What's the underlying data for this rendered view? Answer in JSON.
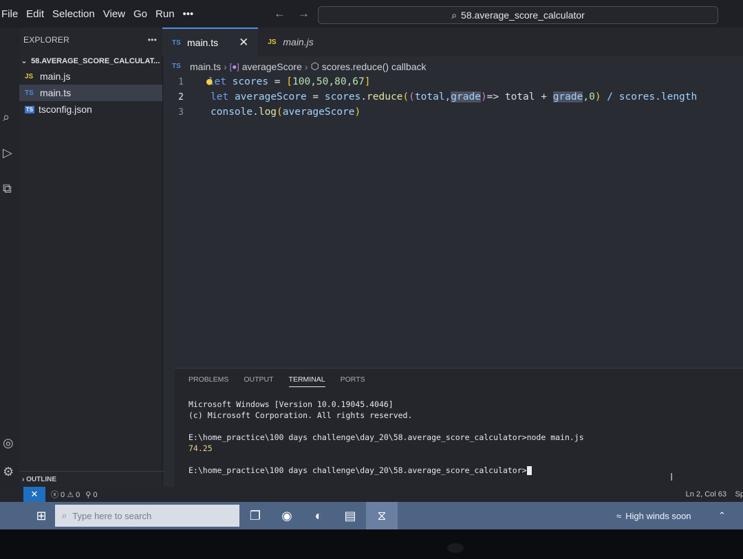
{
  "menu": {
    "items": [
      "File",
      "Edit",
      "Selection",
      "View",
      "Go",
      "Run",
      "•••"
    ]
  },
  "nav": {
    "back": "←",
    "forward": "→"
  },
  "command_center": {
    "text": "58.average_score_calculator"
  },
  "sidebar": {
    "title": "EXPLORER",
    "more": "•••",
    "folder": "58.AVERAGE_SCORE_CALCULAT...",
    "files": [
      {
        "icon": "JS",
        "name": "main.js"
      },
      {
        "icon": "TS",
        "name": "main.ts"
      },
      {
        "icon": "TS",
        "name": "tsconfig.json"
      }
    ],
    "outline": "OUTLINE"
  },
  "tabs": [
    {
      "icon": "TS",
      "label": "main.ts",
      "close": "✕"
    },
    {
      "icon": "JS",
      "label": "main.js"
    }
  ],
  "breadcrumb": {
    "file": "main.ts",
    "symbol1": "averageScore",
    "symbol2": "scores.reduce() callback"
  },
  "code": {
    "line_numbers": [
      "1",
      "2",
      "3"
    ],
    "line1": {
      "kw": "let",
      "var": "scores",
      "eq": " = ",
      "open": "[",
      "nums": "100,50,80,67",
      "close": "]"
    },
    "line2": {
      "kw": "let",
      "var": "averageScore",
      "eq": " = ",
      "obj": "scores",
      "dot": ".",
      "fn": "reduce",
      "p1": "(",
      "p2": "(",
      "arg1": "total,",
      "arg2": "grade",
      "p3": ")",
      "arrow": "=> total + ",
      "arg3": "grade",
      "rest": ",0",
      "p4": ")",
      "tail": " / scores.length"
    },
    "line3": {
      "obj": "console",
      "dot": ".",
      "fn": "log",
      "open": "(",
      "arg": "averageScore",
      "close": ")"
    }
  },
  "panel": {
    "tabs": [
      "PROBLEMS",
      "OUTPUT",
      "TERMINAL",
      "PORTS"
    ],
    "terminal": {
      "line1": "Microsoft Windows [Version 10.0.19045.4046]",
      "line2": "(c) Microsoft Corporation. All rights reserved.",
      "line3": "E:\\home_practice\\100 days challenge\\day_20\\58.average_score_calculator>node main.js",
      "output": "74.25",
      "prompt": "E:\\home_practice\\100 days challenge\\day_20\\58.average_score_calculator>"
    }
  },
  "statusbar": {
    "remote": "✕",
    "problems": "ⓧ 0 ⚠ 0",
    "ports": "⚲ 0",
    "position": "Ln 2, Col 63",
    "spaces": "Sp"
  },
  "taskbar": {
    "search_placeholder": "Type here to search",
    "weather": "High winds soon"
  }
}
